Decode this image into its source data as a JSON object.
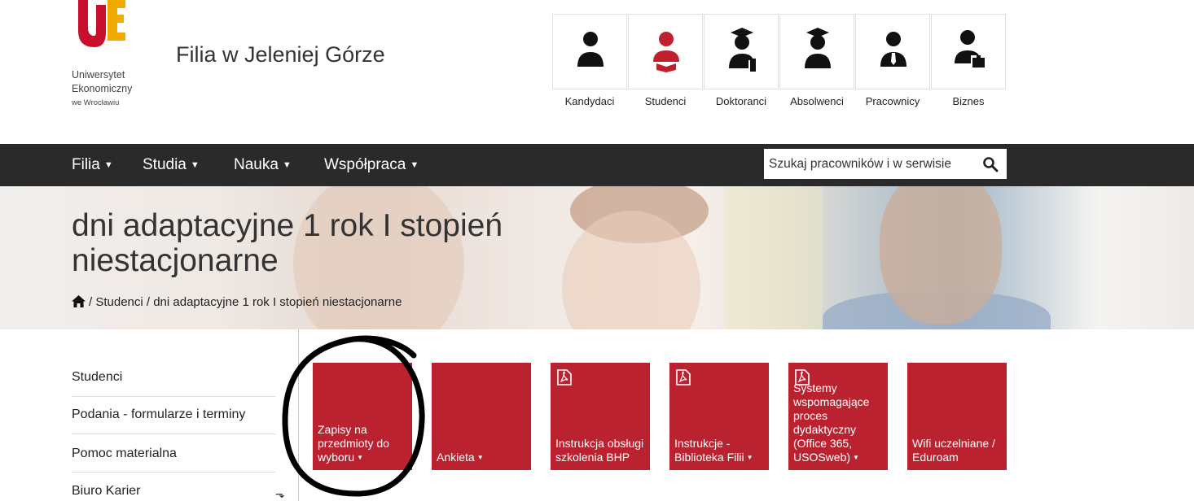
{
  "header": {
    "logo": {
      "line1": "Uniwersytet",
      "line2": "Ekonomiczny",
      "line3": "we Wrocławiu",
      "color_primary": "#c8102e",
      "color_secondary": "#f2a900"
    },
    "site_title": "Filia w Jeleniej Górze",
    "audience": [
      {
        "label": "Kandydaci",
        "icon": "person-icon",
        "color": "#111111"
      },
      {
        "label": "Studenci",
        "icon": "student-book-icon",
        "color": "#c0202e"
      },
      {
        "label": "Doktoranci",
        "icon": "graduate-diploma-icon",
        "color": "#111111"
      },
      {
        "label": "Absolwenci",
        "icon": "graduate-icon",
        "color": "#111111"
      },
      {
        "label": "Pracownicy",
        "icon": "employee-tie-icon",
        "color": "#111111"
      },
      {
        "label": "Biznes",
        "icon": "businessman-briefcase-icon",
        "color": "#111111"
      }
    ]
  },
  "nav": {
    "items": [
      "Filia",
      "Studia",
      "Nauka",
      "Współpraca"
    ],
    "search_placeholder": "Szukaj pracowników i w serwisie"
  },
  "hero": {
    "title": "dni adaptacyjne 1 rok I stopień niestacjonarne",
    "breadcrumb": "/ Studenci / dni adaptacyjne 1 rok I stopień niestacjonarne"
  },
  "sidebar": {
    "items": [
      "Studenci",
      "Podania - formularze i terminy",
      "Pomoc materialna",
      "Biuro Karier"
    ]
  },
  "tiles": [
    {
      "label": "Zapisy na przedmioty do wyboru",
      "pdf": false,
      "arrow": true
    },
    {
      "label": "Ankieta",
      "pdf": false,
      "arrow": true
    },
    {
      "label": "Instrukcja obsługi szkolenia BHP",
      "pdf": true,
      "arrow": false
    },
    {
      "label": "Instrukcje - Biblioteka Filii",
      "pdf": true,
      "arrow": true
    },
    {
      "label": "Systemy wspomagające proces dydaktyczny (Office 365, USOSweb)",
      "pdf": true,
      "arrow": true
    },
    {
      "label": "Wifi uczelniane / Eduroam",
      "pdf": false,
      "arrow": false
    }
  ],
  "colors": {
    "tile": "#bb2230",
    "navbar": "#2a2a2a"
  }
}
